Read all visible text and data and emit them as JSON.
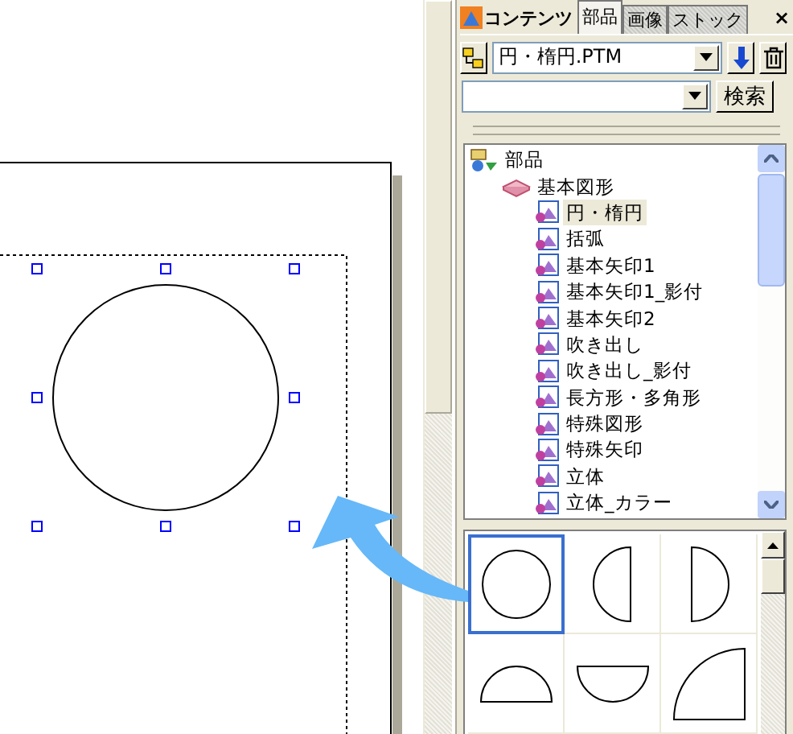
{
  "panel": {
    "header_tab": "コンテンツ",
    "tabs": [
      {
        "label": "部品",
        "selected": true
      },
      {
        "label": "画像",
        "selected": false
      },
      {
        "label": "ストック",
        "selected": false
      }
    ],
    "close": "×",
    "file_combo": {
      "value": "円・楕円.PTM"
    },
    "search_button": "検索",
    "tree": [
      {
        "label": "部品",
        "kind": "root",
        "selected": false,
        "children": [
          {
            "label": "基本図形",
            "kind": "folder",
            "selected": false,
            "children": [
              {
                "label": "円・楕円",
                "kind": "item",
                "selected": true
              },
              {
                "label": "括弧",
                "kind": "item",
                "selected": false
              },
              {
                "label": "基本矢印1",
                "kind": "item",
                "selected": false
              },
              {
                "label": "基本矢印1_影付",
                "kind": "item",
                "selected": false
              },
              {
                "label": "基本矢印2",
                "kind": "item",
                "selected": false
              },
              {
                "label": "吹き出し",
                "kind": "item",
                "selected": false
              },
              {
                "label": "吹き出し_影付",
                "kind": "item",
                "selected": false
              },
              {
                "label": "長方形・多角形",
                "kind": "item",
                "selected": false
              },
              {
                "label": "特殊図形",
                "kind": "item",
                "selected": false
              },
              {
                "label": "特殊矢印",
                "kind": "item",
                "selected": false
              },
              {
                "label": "立体",
                "kind": "item",
                "selected": false
              },
              {
                "label": "立体_カラー",
                "kind": "item",
                "selected": false
              }
            ]
          }
        ]
      }
    ],
    "thumbnails": [
      {
        "kind": "circle",
        "selected": true
      },
      {
        "kind": "half-left",
        "selected": false
      },
      {
        "kind": "half-right",
        "selected": false
      },
      {
        "kind": "half-top",
        "selected": false
      },
      {
        "kind": "half-bottom",
        "selected": false
      },
      {
        "kind": "quarter",
        "selected": false
      }
    ]
  }
}
